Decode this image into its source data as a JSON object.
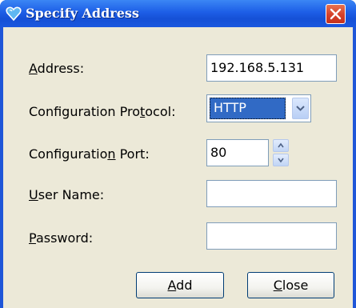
{
  "window": {
    "title": "Specify Address",
    "title_icon": "heart-shield-icon",
    "close_icon": "close-x-icon"
  },
  "form": {
    "address": {
      "label_prefix": "",
      "label_key": "A",
      "label_rest": "ddress:",
      "value": "192.168.5.131"
    },
    "protocol": {
      "label_prefix": "Configuration Pro",
      "label_key": "t",
      "label_rest": "ocol:",
      "value": "HTTP"
    },
    "port": {
      "label_prefix": "Configuratio",
      "label_key": "n",
      "label_rest": " Port:",
      "value": "80"
    },
    "username": {
      "label_prefix": "",
      "label_key": "U",
      "label_rest": "ser Name:",
      "value": ""
    },
    "password": {
      "label_prefix": "",
      "label_key": "P",
      "label_rest": "assword:",
      "value": ""
    }
  },
  "buttons": {
    "add": {
      "label_key": "A",
      "label_rest": "dd"
    },
    "close": {
      "label_key": "C",
      "label_rest": "lose"
    }
  },
  "colors": {
    "titlebar": "#1d5ee6",
    "selection": "#316ac5",
    "dialog_bg": "#ece9d8",
    "close_button": "#d5402a"
  }
}
